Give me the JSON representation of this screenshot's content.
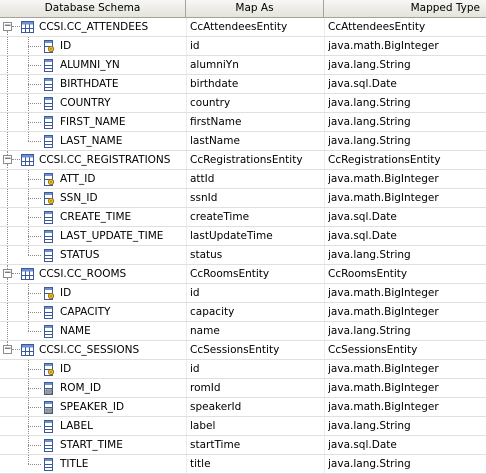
{
  "header": {
    "col_schema": "Database Schema",
    "col_map": "Map As",
    "col_type": "Mapped Type"
  },
  "rows": [
    {
      "level": 0,
      "kind": "table",
      "schema": "CCSI.CC_ATTENDEES",
      "map": "CcAttendeesEntity",
      "type": "CcAttendeesEntity",
      "toggle": "−",
      "icon": "table-icon"
    },
    {
      "level": 1,
      "kind": "column",
      "key": true,
      "schema": "ID",
      "map": "id",
      "type": "java.math.BigInteger",
      "icon": "primary-key-column-icon"
    },
    {
      "level": 1,
      "kind": "column",
      "schema": "ALUMNI_YN",
      "map": "alumniYn",
      "type": "java.lang.String",
      "icon": "column-icon"
    },
    {
      "level": 1,
      "kind": "column",
      "schema": "BIRTHDATE",
      "map": "birthdate",
      "type": "java.sql.Date",
      "icon": "column-icon"
    },
    {
      "level": 1,
      "kind": "column",
      "schema": "COUNTRY",
      "map": "country",
      "type": "java.lang.String",
      "icon": "column-icon"
    },
    {
      "level": 1,
      "kind": "column",
      "schema": "FIRST_NAME",
      "map": "firstName",
      "type": "java.lang.String",
      "icon": "column-icon"
    },
    {
      "level": 1,
      "kind": "column",
      "schema": "LAST_NAME",
      "map": "lastName",
      "type": "java.lang.String",
      "icon": "column-icon",
      "last": true
    },
    {
      "level": 0,
      "kind": "table",
      "schema": "CCSI.CC_REGISTRATIONS",
      "map": "CcRegistrationsEntity",
      "type": "CcRegistrationsEntity",
      "toggle": "−",
      "icon": "table-icon"
    },
    {
      "level": 1,
      "kind": "column",
      "key": true,
      "schema": "ATT_ID",
      "map": "attId",
      "type": "java.math.BigInteger",
      "icon": "primary-key-column-icon"
    },
    {
      "level": 1,
      "kind": "column",
      "key": true,
      "schema": "SSN_ID",
      "map": "ssnId",
      "type": "java.math.BigInteger",
      "icon": "primary-key-column-icon"
    },
    {
      "level": 1,
      "kind": "column",
      "schema": "CREATE_TIME",
      "map": "createTime",
      "type": "java.sql.Date",
      "icon": "column-icon"
    },
    {
      "level": 1,
      "kind": "column",
      "schema": "LAST_UPDATE_TIME",
      "map": "lastUpdateTime",
      "type": "java.sql.Date",
      "icon": "column-icon"
    },
    {
      "level": 1,
      "kind": "column",
      "schema": "STATUS",
      "map": "status",
      "type": "java.lang.String",
      "icon": "column-icon",
      "last": true
    },
    {
      "level": 0,
      "kind": "table",
      "schema": "CCSI.CC_ROOMS",
      "map": "CcRoomsEntity",
      "type": "CcRoomsEntity",
      "toggle": "−",
      "icon": "table-icon"
    },
    {
      "level": 1,
      "kind": "column",
      "key": true,
      "schema": "ID",
      "map": "id",
      "type": "java.math.BigInteger",
      "icon": "primary-key-column-icon"
    },
    {
      "level": 1,
      "kind": "column",
      "schema": "CAPACITY",
      "map": "capacity",
      "type": "java.math.BigInteger",
      "icon": "column-icon"
    },
    {
      "level": 1,
      "kind": "column",
      "schema": "NAME",
      "map": "name",
      "type": "java.lang.String",
      "icon": "column-icon",
      "last": true
    },
    {
      "level": 0,
      "kind": "table",
      "schema": "CCSI.CC_SESSIONS",
      "map": "CcSessionsEntity",
      "type": "CcSessionsEntity",
      "toggle": "−",
      "icon": "table-icon",
      "lastTable": true
    },
    {
      "level": 1,
      "kind": "column",
      "key": true,
      "schema": "ID",
      "map": "id",
      "type": "java.math.BigInteger",
      "icon": "primary-key-column-icon"
    },
    {
      "level": 1,
      "kind": "column",
      "fk": true,
      "schema": "ROM_ID",
      "map": "romId",
      "type": "java.math.BigInteger",
      "icon": "foreign-key-column-icon"
    },
    {
      "level": 1,
      "kind": "column",
      "fk": true,
      "schema": "SPEAKER_ID",
      "map": "speakerId",
      "type": "java.math.BigInteger",
      "icon": "foreign-key-column-icon"
    },
    {
      "level": 1,
      "kind": "column",
      "schema": "LABEL",
      "map": "label",
      "type": "java.lang.String",
      "icon": "column-icon"
    },
    {
      "level": 1,
      "kind": "column",
      "schema": "START_TIME",
      "map": "startTime",
      "type": "java.sql.Date",
      "icon": "column-icon"
    },
    {
      "level": 1,
      "kind": "column",
      "schema": "TITLE",
      "map": "title",
      "type": "java.lang.String",
      "icon": "column-icon",
      "last": true
    }
  ]
}
